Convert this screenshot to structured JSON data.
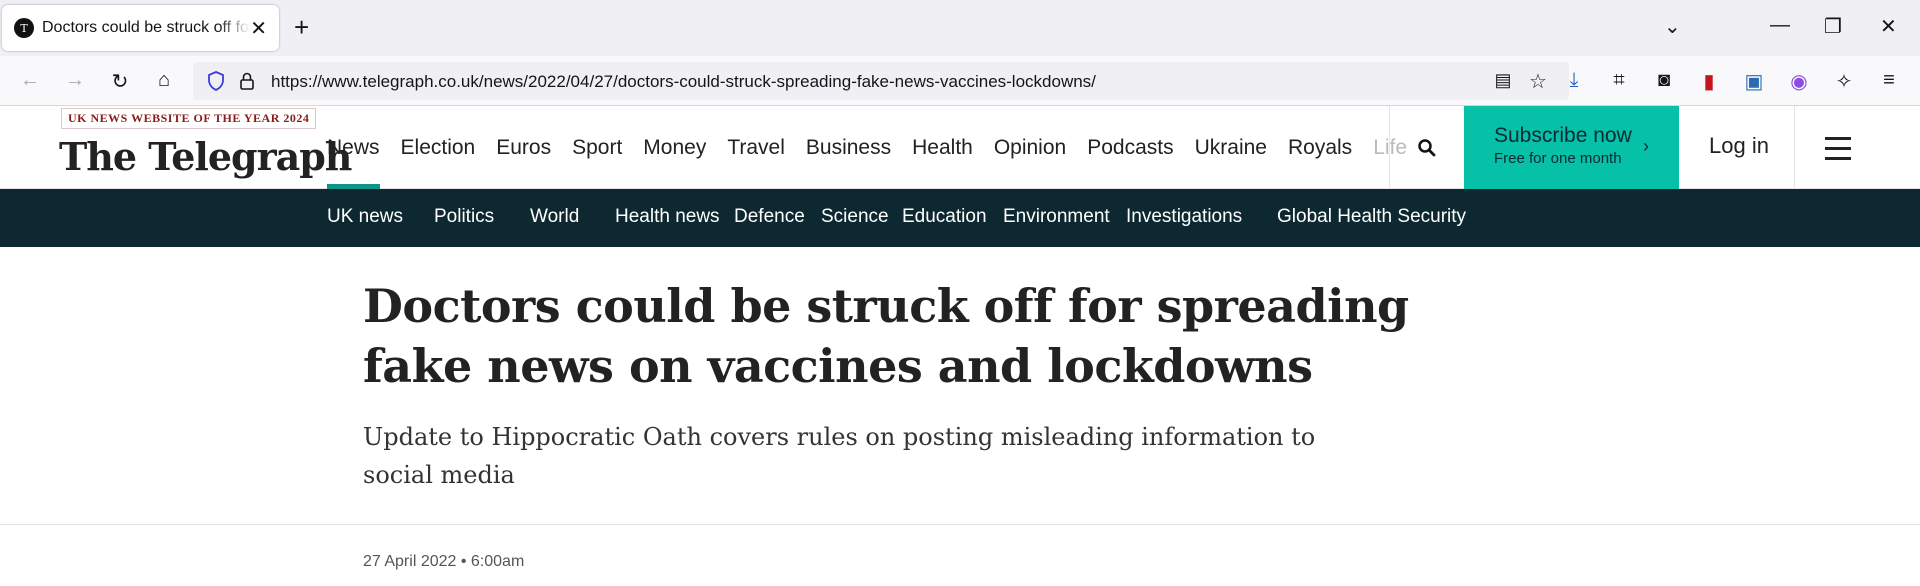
{
  "browser": {
    "tab_title": "Doctors could be struck off for spreading fake news on vaccines and lockdowns",
    "url": "https://www.telegraph.co.uk/news/2022/04/27/doctors-could-struck-spreading-fake-news-vaccines-lockdowns/"
  },
  "site": {
    "award": "UK NEWS WEBSITE OF THE YEAR 2024",
    "logo": "The Telegraph",
    "brand_color": "#06c0a7",
    "nav_color": "#0d2830",
    "main_nav": [
      "News",
      "Election",
      "Euros",
      "Sport",
      "Money",
      "Travel",
      "Business",
      "Health",
      "Opinion",
      "Podcasts",
      "Ukraine",
      "Royals",
      "Life"
    ],
    "active_nav": "News",
    "subscribe_title": "Subscribe now",
    "subscribe_sub": "Free for one month",
    "subscribe_chevron": "›",
    "login": "Log in",
    "sub_nav": [
      "UK news",
      "Politics",
      "World",
      "Health news",
      "Defence",
      "Science",
      "Education",
      "Environment",
      "Investigations",
      "Global Health Security"
    ]
  },
  "article": {
    "headline": "Doctors could be struck off for spreading fake news on vaccines and lockdowns",
    "standfirst": "Update to Hippocratic Oath covers rules on posting misleading information to social media",
    "date": "27 April 2022 • 6:00am"
  }
}
